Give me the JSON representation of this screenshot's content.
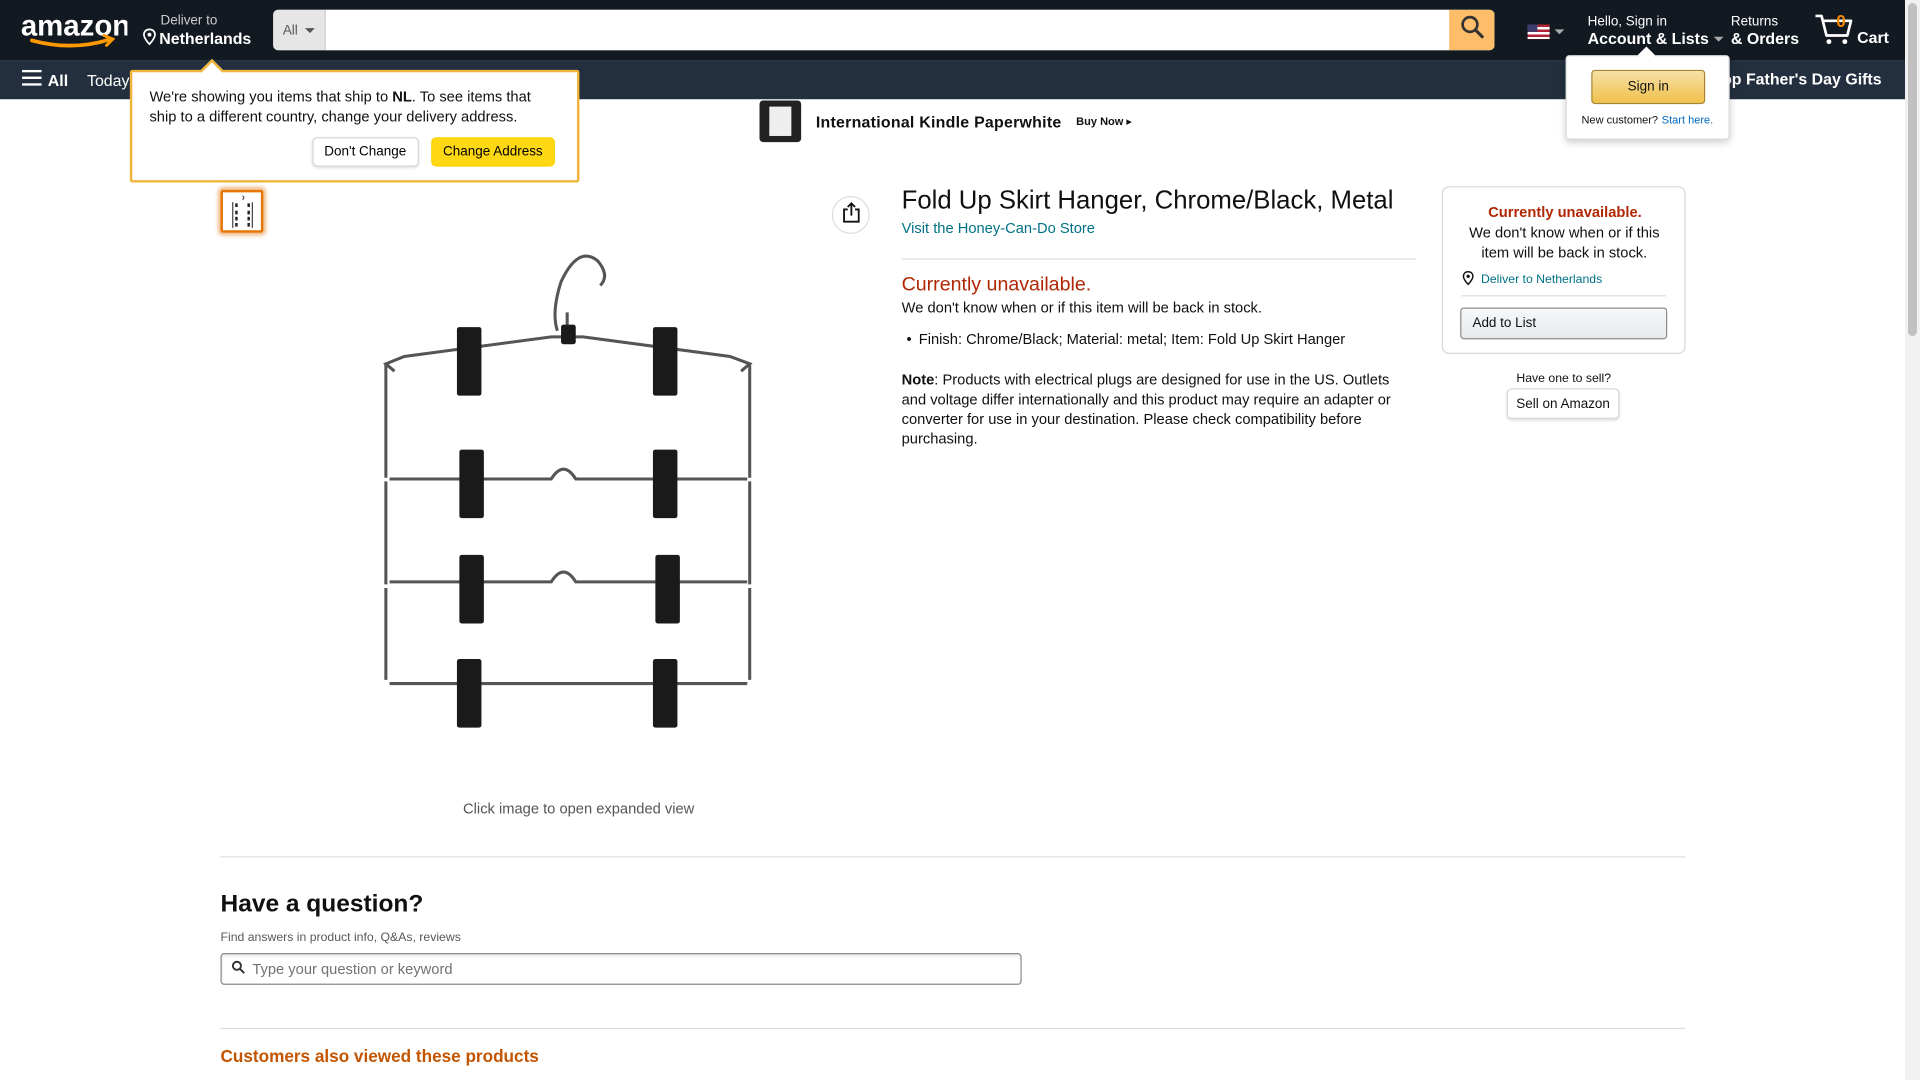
{
  "header": {
    "deliver_line1": "Deliver to",
    "deliver_line2": "Netherlands",
    "search_category": "All",
    "search_placeholder": "",
    "account_line1": "Hello, Sign in",
    "account_line2": "Account & Lists",
    "returns_line1": "Returns",
    "returns_line2": "& Orders",
    "cart_count": "0",
    "cart_label": "Cart"
  },
  "subnav": {
    "all_label": "All",
    "today_label": "Today's",
    "fathers_day": "Shop Father's Day Gifts"
  },
  "address_popover": {
    "text_pre": "We're showing you items that ship to ",
    "country": "NL",
    "text_post": ". To see items that ship to a different country, change your delivery address.",
    "dont_change": "Don't Change",
    "change_address": "Change Address"
  },
  "signin_popover": {
    "sign_in": "Sign in",
    "new_customer": "New customer?",
    "start_here": "Start here."
  },
  "banner": {
    "title": "International Kindle Paperwhite",
    "buy_now": "Buy Now ▸"
  },
  "product": {
    "title": "Fold Up Skirt Hanger, Chrome/Black, Metal",
    "store_link": "Visit the Honey-Can-Do Store",
    "unavailable": "Currently unavailable.",
    "unavailable_sub": "We don't know when or if this item will be back in stock.",
    "bullet": "Finish: Chrome/Black; Material: metal; Item: Fold Up Skirt Hanger",
    "note_label": "Note",
    "note_text": ": Products with electrical plugs are designed for use in the US. Outlets and voltage differ internationally and this product may require an adapter or converter for use in your destination. Please check compatibility before purchasing.",
    "click_image": "Click image to open expanded view"
  },
  "buybox": {
    "unavailable": "Currently unavailable.",
    "unavailable_sub": "We don't know when or if this item will be back in stock.",
    "deliver": "Deliver to Netherlands",
    "add_to_list": "Add to List",
    "have_one": "Have one to sell?",
    "sell_on_amazon": "Sell on Amazon"
  },
  "qa": {
    "title": "Have a question?",
    "subtitle": "Find answers in product info, Q&As, reviews",
    "placeholder": "Type your question or keyword"
  },
  "also_viewed": "Customers also viewed these products",
  "colors": {
    "nav_dark": "#131921",
    "nav_sub": "#232f3e",
    "accent_orange": "#febd69",
    "unavailable_red": "#b12704",
    "link": "#007185"
  }
}
